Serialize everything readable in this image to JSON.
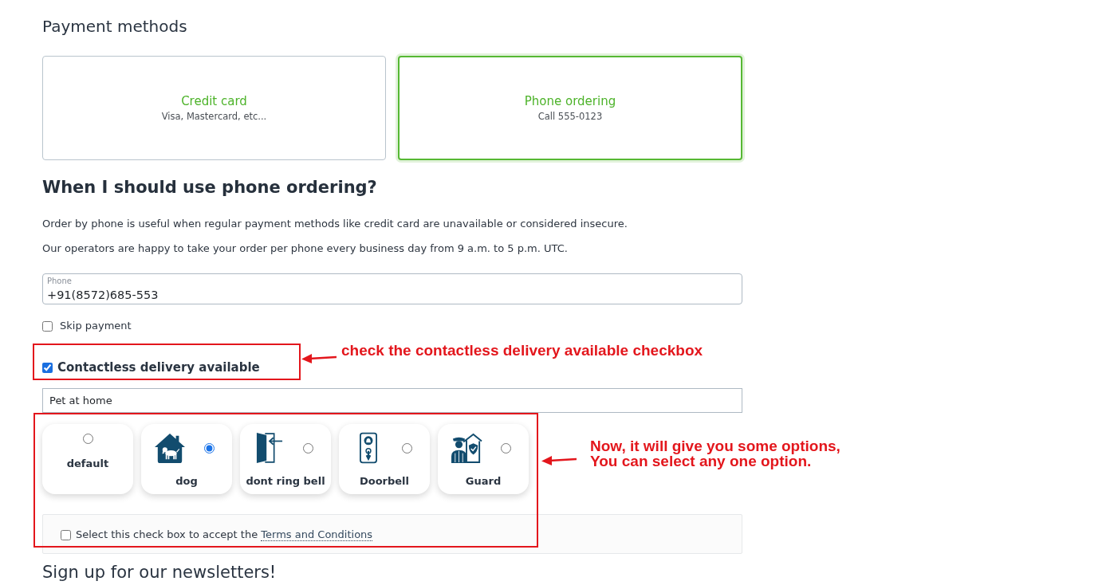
{
  "payment_section": {
    "title": "Payment methods"
  },
  "payment_methods": [
    {
      "title": "Credit card",
      "subtitle": "Visa, Mastercard, etc...",
      "selected": false
    },
    {
      "title": "Phone ordering",
      "subtitle": "Call 555-0123",
      "selected": true
    }
  ],
  "info": {
    "title": "When I should use phone ordering?",
    "paragraphs": [
      "Order by phone is useful when regular payment methods like credit card are unavailable or considered insecure.",
      "Our operators are happy to take your order per phone every business day from 9 a.m. to 5 p.m. UTC."
    ]
  },
  "phone": {
    "label": "Phone",
    "value": "+91(8572)685-553"
  },
  "skip_payment": {
    "label": "Skip payment",
    "checked": false
  },
  "contactless_delivery": {
    "label": "Contactless delivery available",
    "checked": true
  },
  "delivery_note": {
    "value": "Pet at home"
  },
  "delivery_options": [
    {
      "kind": "plain",
      "label": "default",
      "selected": false
    },
    {
      "kind": "icon",
      "label": "dog",
      "selected": true
    },
    {
      "kind": "icon",
      "label": "dont ring bell",
      "selected": false
    },
    {
      "kind": "icon",
      "label": "Doorbell",
      "selected": false
    },
    {
      "kind": "icon",
      "label": "Guard",
      "selected": false
    }
  ],
  "terms": {
    "text": "Select this check box to accept the",
    "link": "Terms and Conditions",
    "checked": false
  },
  "newsletter": {
    "title": "Sign up for our newsletters!"
  },
  "annotations": [
    {
      "text": "check the contactless delivery available checkbox"
    },
    {
      "text": "Now, it will give you some options,\nYou can select any one option."
    }
  ]
}
